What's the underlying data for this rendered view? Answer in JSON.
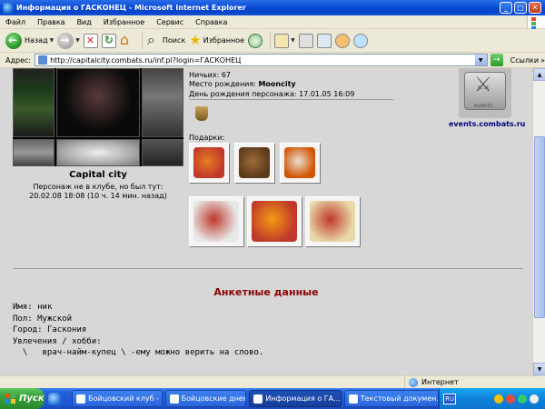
{
  "window": {
    "title": "Информация о ГАСКОНЕЦ - Microsoft Internet Explorer",
    "minimize": "_",
    "maximize": "□",
    "close": "✕"
  },
  "menu": [
    "Файл",
    "Правка",
    "Вид",
    "Избранное",
    "Сервис",
    "Справка"
  ],
  "toolbar": {
    "back_label": "Назад",
    "search_label": "Поиск",
    "favorites_label": "Избранное"
  },
  "address": {
    "label": "Адрес:",
    "url": "http://capitalcity.combats.ru/inf.pl?login=ГАСКОНЕЦ",
    "go": "→",
    "links_label": "Ссылки",
    "links_arrow": "»"
  },
  "profile": {
    "details": {
      "wins_label": "Ничьих:",
      "wins_value": "67",
      "birthplace_label": "Место рождения:",
      "birthplace_value": "Mooncity",
      "birthday_label": "День рождения персонажа:",
      "birthday_value": "17.01.05 16:09"
    },
    "gifts_label": "Подарки:",
    "city_name": "Capital city",
    "last_seen_line1": "Персонаж не в клубе, но был тут:",
    "last_seen_line2": "20.02.08 18:08 (10 ч. 14 мин. назад)",
    "events_link": "events.combats.ru",
    "events_badge_text": "events",
    "events_badge_glyph": "⚔",
    "section_title": "Анкетные данные",
    "fields": [
      {
        "label": "Имя:",
        "value": "ник"
      },
      {
        "label": "Пол:",
        "value": "Мужской"
      },
      {
        "label": "Город:",
        "value": "Гаскония"
      },
      {
        "label": "Увлечения / хобби:",
        "value": ""
      }
    ],
    "hobby_line": "  \\   врач-найм-купец \\ -ему можно верить на слово."
  },
  "gift_colors": [
    [
      "#c0392b",
      "#e67e22"
    ],
    [
      "#5a3a1a",
      "#a06a3a"
    ],
    [
      "#d35400",
      "#e8e0d0"
    ],
    [
      "#e8e8e8",
      "#c0392b"
    ],
    [
      "#c0392b",
      "#f39c12"
    ],
    [
      "#e8d9a8",
      "#c0392b"
    ]
  ],
  "status": {
    "zone": "Интернет"
  },
  "taskbar": {
    "start": "Пуск",
    "tasks": [
      "Бойцовский клуб - ...",
      "Бойцовские дневни...",
      "Информация о ГА...",
      "Текстовый докумен..."
    ],
    "lang": "RU"
  }
}
